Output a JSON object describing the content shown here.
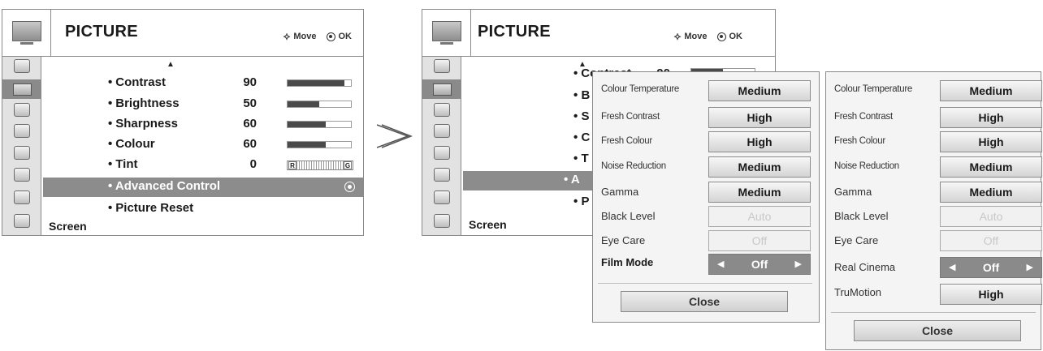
{
  "menu": {
    "title": "PICTURE",
    "hint_move": "Move",
    "hint_ok": "OK",
    "screen_label": "Screen",
    "items": [
      {
        "label": "Contrast",
        "value": "90",
        "level": 90
      },
      {
        "label": "Brightness",
        "value": "50",
        "level": 50
      },
      {
        "label": "Sharpness",
        "value": "60",
        "level": 60
      },
      {
        "label": "Colour",
        "value": "60",
        "level": 60
      },
      {
        "label": "Tint",
        "value": "0",
        "tint_left": "R",
        "tint_right": "G"
      }
    ],
    "selected_item": "Advanced Control",
    "reset_item": "Picture Reset",
    "bullet": "•",
    "sidebar_icons": [
      "audio-icon",
      "picture-icon",
      "setup-icon",
      "time-icon",
      "option-icon",
      "lock-icon",
      "input-icon",
      "usb-icon"
    ]
  },
  "popup1": {
    "rows": [
      {
        "label": "Colour Temperature",
        "value": "Medium"
      },
      {
        "label": "Fresh Contrast",
        "value": "High"
      },
      {
        "label": "Fresh Colour",
        "value": "High"
      },
      {
        "label": "Noise Reduction",
        "value": "Medium"
      },
      {
        "label": "Gamma",
        "value": "Medium"
      },
      {
        "label": "Black Level",
        "value": "Auto"
      },
      {
        "label": "Eye Care",
        "value": "Off"
      },
      {
        "label": "Film Mode",
        "value": "Off"
      }
    ],
    "close": "Close"
  },
  "popup2": {
    "rows": [
      {
        "label": "Colour Temperature",
        "value": "Medium"
      },
      {
        "label": "Fresh Contrast",
        "value": "High"
      },
      {
        "label": "Fresh Colour",
        "value": "High"
      },
      {
        "label": "Noise Reduction",
        "value": "Medium"
      },
      {
        "label": "Gamma",
        "value": "Medium"
      },
      {
        "label": "Black Level",
        "value": "Auto"
      },
      {
        "label": "Eye Care",
        "value": "Off"
      },
      {
        "label": "Real Cinema",
        "value": "Off"
      },
      {
        "label": "TruMotion",
        "value": "High"
      }
    ],
    "close": "Close"
  },
  "left_menu_partial": {
    "contrast_prefix": "Contrast",
    "contrast_value": "90",
    "letters": [
      "B",
      "S",
      "C",
      "T",
      "A",
      "P"
    ]
  },
  "colors": {
    "border": "#8a8a8a",
    "highlight": "#8c8c8c",
    "bar": "#4a4a4a",
    "sidebar": "#e2e2e2"
  }
}
